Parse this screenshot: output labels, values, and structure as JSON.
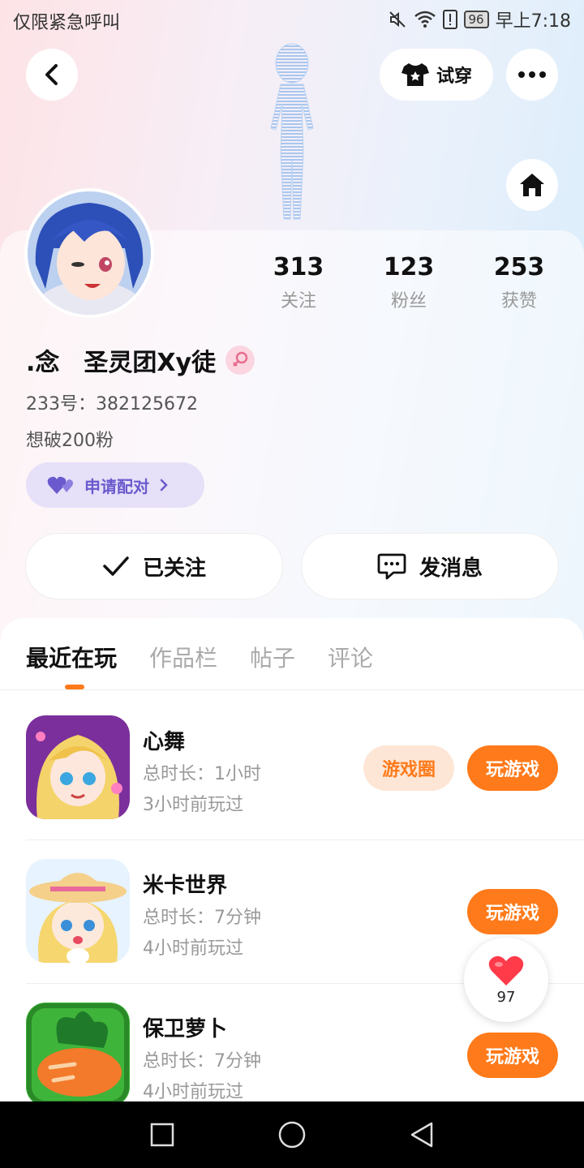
{
  "status_bar": {
    "left_text": "仅限紧急呼叫",
    "battery": "96",
    "time": "早上7:18"
  },
  "header": {
    "tryon_label": "试穿"
  },
  "profile": {
    "stats": [
      {
        "num": "313",
        "label": "关注"
      },
      {
        "num": "123",
        "label": "粉丝"
      },
      {
        "num": "253",
        "label": "获赞"
      }
    ],
    "username": ".念　圣灵团Xy徒",
    "user_id": "233号：382125672",
    "bio": "想破200粉",
    "match_label": "申请配对",
    "follow_label": "已关注",
    "message_label": "发消息"
  },
  "tabs": [
    {
      "label": "最近在玩"
    },
    {
      "label": "作品栏"
    },
    {
      "label": "帖子"
    },
    {
      "label": "评论"
    }
  ],
  "games": [
    {
      "name": "心舞",
      "duration": "总时长：1小时",
      "last_played": "3小时前玩过",
      "circle_label": "游戏圈",
      "play_label": "玩游戏"
    },
    {
      "name": "米卡世界",
      "duration": "总时长：7分钟",
      "last_played": "4小时前玩过",
      "play_label": "玩游戏"
    },
    {
      "name": "保卫萝卜",
      "duration": "总时长：7分钟",
      "last_played": "4小时前玩过",
      "play_label": "玩游戏"
    }
  ],
  "like_fab": {
    "count": "97"
  },
  "colors": {
    "accent": "#ff7a1a",
    "match": "#6a5acd"
  }
}
